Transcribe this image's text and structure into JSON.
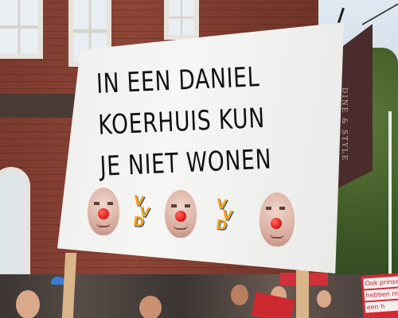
{
  "main_sign": {
    "lines": [
      "IN EEN DANIEL",
      "KOERHUIS KUN",
      "JE NIET WONEN"
    ]
  },
  "logo": {
    "letters": [
      "V",
      "V",
      "D"
    ],
    "colors": {
      "fill": "#f3a21a",
      "outline": "#1a4d9c"
    }
  },
  "banner": {
    "text": "DINE & STYLE"
  },
  "red_sign": {
    "lines": [
      "Ook prinsen",
      "hebben m",
      "een h"
    ]
  },
  "colors": {
    "brick": "#8d4536",
    "sign_board": "#f2f2f1",
    "clown_nose": "#e11f1f",
    "banner": "#4a2c2c"
  }
}
